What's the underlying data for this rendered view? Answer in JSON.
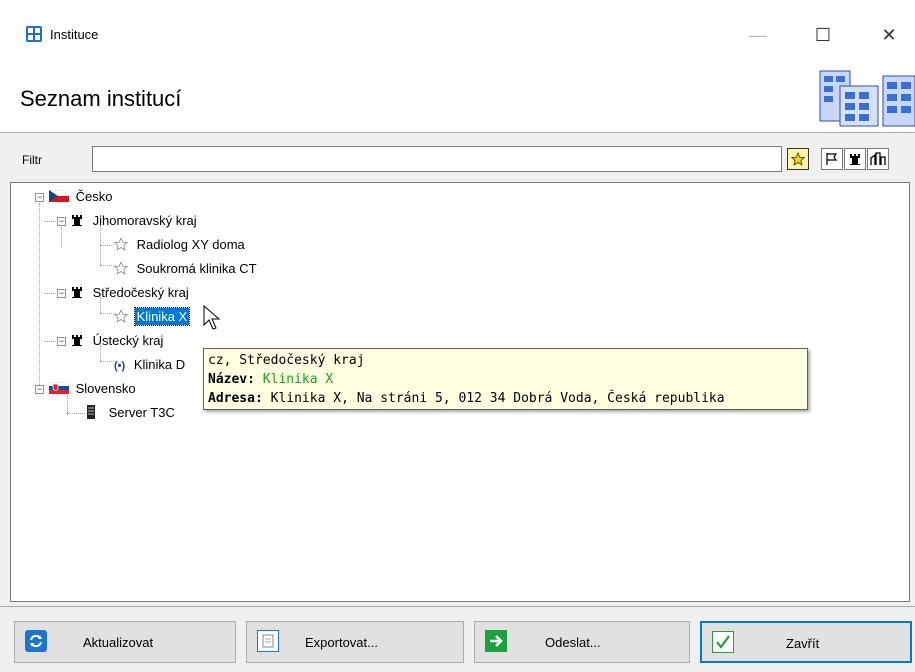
{
  "window": {
    "title": "Instituce",
    "minimize": "—",
    "maximize": "☐",
    "close": "✕"
  },
  "header": {
    "title": "Seznam institucí"
  },
  "filter": {
    "label": "Filtr",
    "value": "",
    "buttons": [
      {
        "name": "favorites-filter-button",
        "icon": "star-icon",
        "active": true
      },
      {
        "name": "country-filter-button",
        "icon": "flag-icon",
        "active": false
      },
      {
        "name": "region-filter-button",
        "icon": "castle-icon",
        "active": false
      },
      {
        "name": "institution-filter-button",
        "icon": "buildings-icon",
        "active": false
      }
    ]
  },
  "tree": {
    "nodes": [
      {
        "label": "Česko",
        "icon": "czech-flag-icon",
        "level": 0
      },
      {
        "label": "Jihomoravský kraj",
        "icon": "castle-icon",
        "level": 1
      },
      {
        "label": "Radiolog XY doma",
        "icon": "star-outline-icon",
        "level": 2
      },
      {
        "label": "Soukromá klinika CT",
        "icon": "star-outline-icon",
        "level": 2
      },
      {
        "label": "Středočeský kraj",
        "icon": "castle-icon",
        "level": 1
      },
      {
        "label": "Klinika X",
        "icon": "star-outline-icon",
        "level": 2,
        "selected": true
      },
      {
        "label": "Ústecký kraj",
        "icon": "castle-icon",
        "level": 1
      },
      {
        "label": "Klinika D",
        "icon": "radio-signal-icon",
        "level": 2
      },
      {
        "label": "Slovensko",
        "icon": "slovak-flag-icon",
        "level": 0
      },
      {
        "label": "Server T3C",
        "icon": "server-icon",
        "level": 1
      }
    ]
  },
  "tooltip": {
    "line1": "cz, Středočeský kraj",
    "name_label": "Název:",
    "name_value": "Klinika X",
    "address_label": "Adresa:",
    "address_value": "Klinika X, Na stráni 5, 012 34 Dobrá Voda, Česká republika"
  },
  "buttons": {
    "refresh": "Aktualizovat",
    "export": "Exportovat...",
    "send": "Odeslat...",
    "close": "Zavřít"
  },
  "colors": {
    "accent": "#0078d7",
    "tooltip_bg": "#ffffe1",
    "tooltip_value": "#1aa11a"
  }
}
